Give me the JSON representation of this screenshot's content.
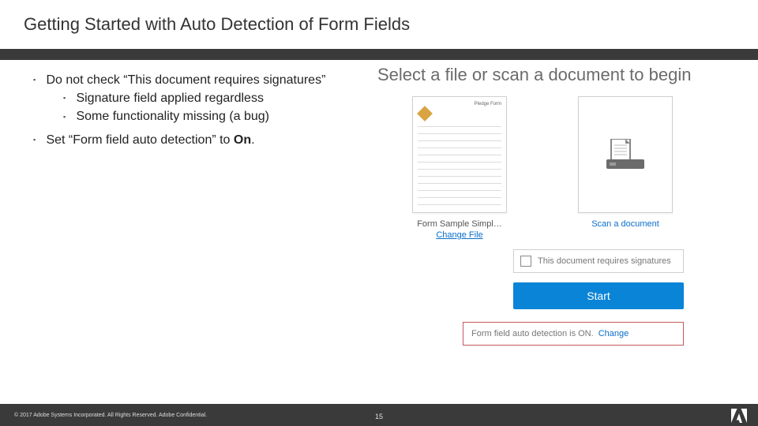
{
  "slide": {
    "title": "Getting Started with Auto Detection of Form Fields",
    "bullets": [
      {
        "text": "Do not check “This document requires signatures”",
        "children": [
          {
            "text": "Signature field applied regardless"
          },
          {
            "text": "Some functionality missing (a bug)"
          }
        ]
      },
      {
        "text_prefix": "Set “Form field auto detection” to ",
        "text_bold": "On",
        "text_suffix": "."
      }
    ]
  },
  "panel": {
    "heading": "Select a file or scan a document to begin",
    "card_file": {
      "doc_title": "Pledge Form",
      "label": "Form Sample Simpl…",
      "link": "Change File"
    },
    "card_scan": {
      "label": "Scan a document"
    },
    "checkbox": {
      "label": "This document requires signatures"
    },
    "start_button": "Start",
    "auto_detect": {
      "text": "Form field auto detection is ON.",
      "change": "Change"
    }
  },
  "footer": {
    "copyright": "© 2017 Adobe Systems Incorporated.  All Rights Reserved.  Adobe Confidential.",
    "page_number": "15"
  }
}
